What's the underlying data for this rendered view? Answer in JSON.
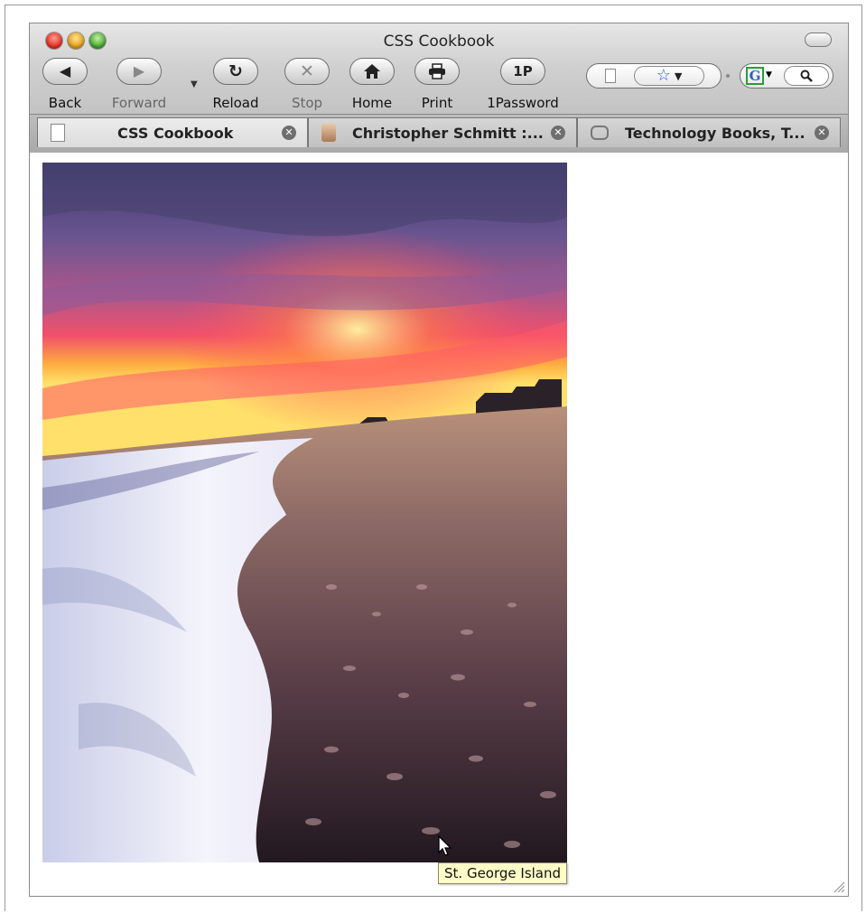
{
  "window": {
    "title": "CSS Cookbook"
  },
  "toolbar": {
    "back_label": "Back",
    "forward_label": "Forward",
    "reload_label": "Reload",
    "stop_label": "Stop",
    "home_label": "Home",
    "print_label": "Print",
    "onepassword_label": "1Password",
    "onepassword_glyph": "1P",
    "search_engine_letter": "G"
  },
  "tabs": [
    {
      "label": "CSS Cookbook",
      "active": true,
      "icon": "page-icon"
    },
    {
      "label": "Christopher Schmitt :...",
      "active": false,
      "icon": "favicon-portrait-icon"
    },
    {
      "label": "Technology Books, T...",
      "active": false,
      "icon": "gamepad-icon"
    }
  ],
  "content": {
    "tooltip": "St. George Island"
  },
  "colors": {
    "tooltip_bg": "#fffcc6",
    "bookmark_star": "#2a63c8"
  }
}
